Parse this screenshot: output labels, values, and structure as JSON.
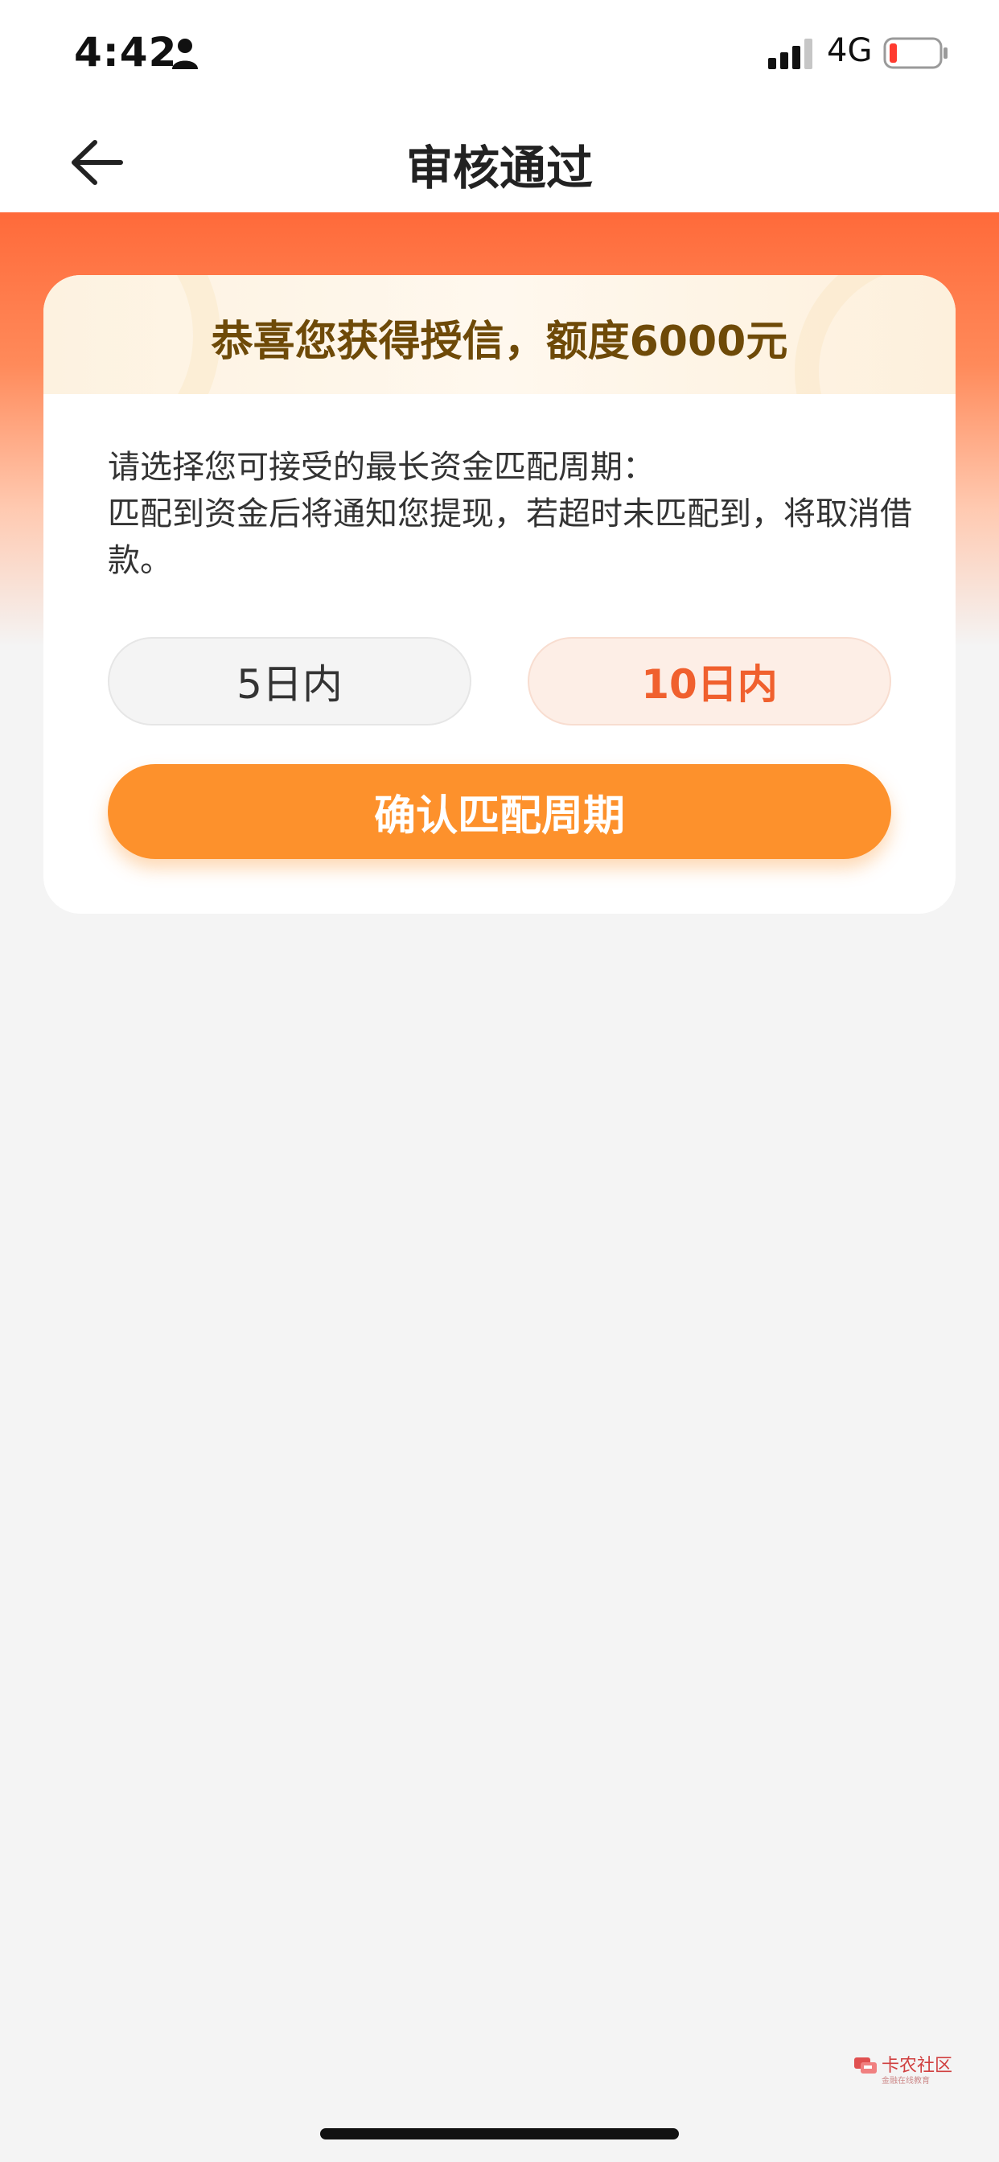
{
  "status_bar": {
    "time": "4:42",
    "network": "4G",
    "icons": [
      "person-icon",
      "signal-icon",
      "battery-icon"
    ],
    "battery_color": "#ff3b30"
  },
  "nav": {
    "title": "审核通过",
    "back_icon": "arrow-left-icon"
  },
  "card": {
    "congrats": "恭喜您获得授信，额度6000元",
    "instructions": "请选择您可接受的最长资金匹配周期：\n匹配到资金后将通知您提现，若超时未匹配到，将取消借款。",
    "options": [
      {
        "label": "5日内",
        "selected": false
      },
      {
        "label": "10日内",
        "selected": true
      }
    ],
    "confirm_label": "确认匹配周期"
  },
  "watermark": {
    "title": "卡农社区",
    "subtitle": "金融在线教育"
  },
  "colors": {
    "accent": "#fd912c",
    "hero_top": "#ff6a3a",
    "selected_text": "#f0602e",
    "congrats_text": "#6e4a08",
    "background": "#f4f4f4"
  }
}
